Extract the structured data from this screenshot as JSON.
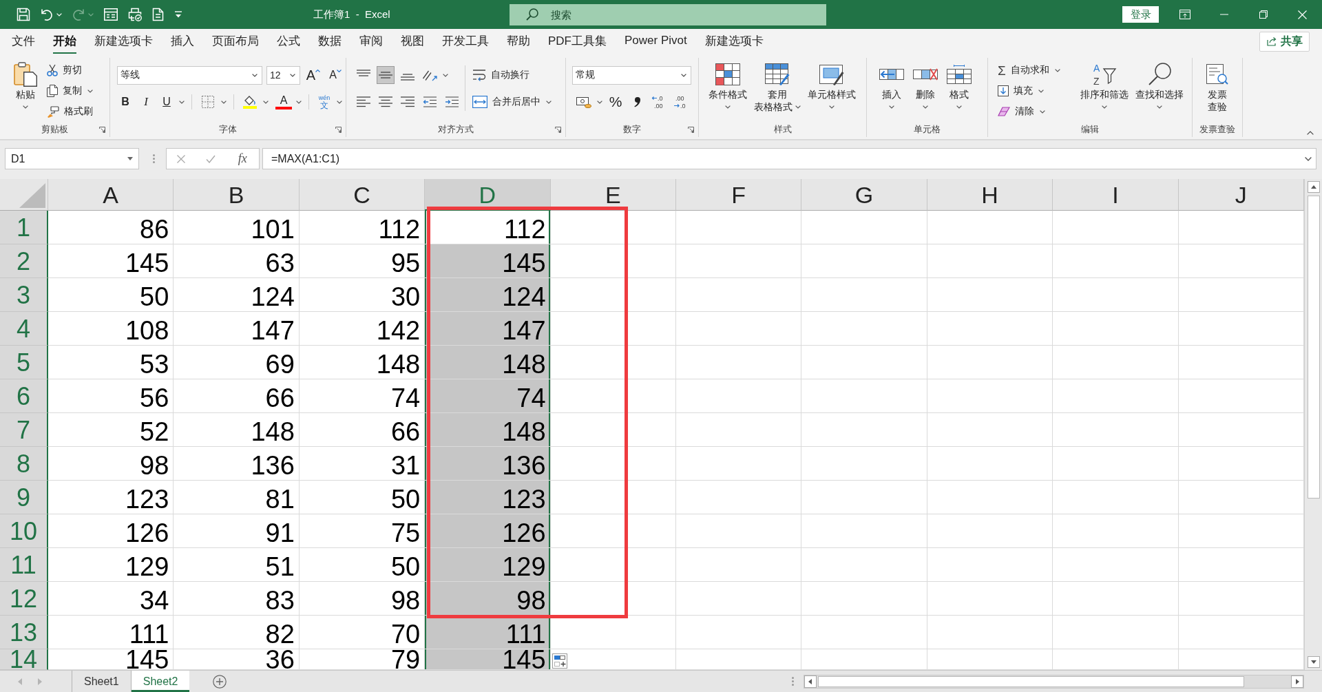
{
  "title_bar": {
    "quick_access": [
      {
        "kind": "save",
        "menu": false,
        "disabled": false
      },
      {
        "kind": "undo",
        "menu": true,
        "disabled": false
      },
      {
        "kind": "redo",
        "menu": true,
        "disabled": true
      },
      {
        "kind": "form",
        "menu": false,
        "disabled": false
      },
      {
        "kind": "preview",
        "menu": false,
        "disabled": false
      },
      {
        "kind": "document",
        "menu": false,
        "disabled": false
      },
      {
        "kind": "customize",
        "menu": false,
        "disabled": false
      }
    ],
    "title": "工作簿1  -  Excel",
    "search": {
      "placeholder": "搜索"
    },
    "sign_in": "登录"
  },
  "tabs": [
    {
      "label": "文件",
      "selected": false
    },
    {
      "label": "开始",
      "selected": true
    },
    {
      "label": "新建选项卡",
      "selected": false
    },
    {
      "label": "插入",
      "selected": false
    },
    {
      "label": "页面布局",
      "selected": false
    },
    {
      "label": "公式",
      "selected": false
    },
    {
      "label": "数据",
      "selected": false
    },
    {
      "label": "审阅",
      "selected": false
    },
    {
      "label": "视图",
      "selected": false
    },
    {
      "label": "开发工具",
      "selected": false
    },
    {
      "label": "帮助",
      "selected": false
    },
    {
      "label": "PDF工具集",
      "selected": false
    },
    {
      "label": "Power Pivot",
      "selected": false
    },
    {
      "label": "新建选项卡",
      "selected": false
    }
  ],
  "share": "共享",
  "ribbon": {
    "groups": [
      {
        "kind": "clipboard",
        "label": "剪贴板",
        "launcher": true,
        "items": [
          {
            "kind": "paste",
            "lines": [
              "粘贴"
            ],
            "menu": true
          },
          {
            "kind": "cut",
            "label": "剪切",
            "menu": false
          },
          {
            "kind": "copy",
            "label": "复制",
            "menu": true
          },
          {
            "kind": "painter",
            "label": "格式刷",
            "menu": false
          }
        ]
      },
      {
        "kind": "font",
        "label": "字体",
        "launcher": true,
        "items": [
          {
            "kind": "fontname",
            "value": "等线",
            "menu": true
          },
          {
            "kind": "fontsize",
            "value": "12",
            "menu": true
          },
          {
            "kind": "grow",
            "label": "A",
            "menu": false
          },
          {
            "kind": "shrink",
            "label": "A",
            "menu": false
          },
          {
            "kind": "bold",
            "label": "B",
            "menu": false
          },
          {
            "kind": "italic",
            "label": "I",
            "menu": false
          },
          {
            "kind": "underline",
            "label": "U",
            "menu": true
          },
          {
            "kind": "borders",
            "menu": true
          },
          {
            "kind": "fill",
            "color": "#ffff00",
            "menu": true
          },
          {
            "kind": "fontcolor",
            "label": "A",
            "color": "#ff0000",
            "menu": true
          },
          {
            "kind": "phonetic",
            "label": "wén",
            "base": "文",
            "menu": true
          }
        ]
      },
      {
        "kind": "alignment",
        "label": "对齐方式",
        "launcher": true,
        "vertical": [
          {
            "kind": "top",
            "selected": false
          },
          {
            "kind": "middle",
            "selected": true
          },
          {
            "kind": "bottom",
            "selected": false
          }
        ],
        "horizontal": [
          {
            "kind": "left",
            "selected": false
          },
          {
            "kind": "center",
            "selected": false
          },
          {
            "kind": "right",
            "selected": false
          }
        ],
        "items": [
          {
            "kind": "orientation",
            "menu": true
          },
          {
            "kind": "wrap",
            "label": "自动换行",
            "menu": false
          },
          {
            "kind": "outdent",
            "menu": false
          },
          {
            "kind": "indent",
            "menu": false
          },
          {
            "kind": "merge",
            "label": "合并后居中",
            "menu": true
          }
        ]
      },
      {
        "kind": "number",
        "label": "数字",
        "launcher": true,
        "items": [
          {
            "kind": "format",
            "value": "常规",
            "menu": true
          },
          {
            "kind": "accounting",
            "menu": true
          },
          {
            "kind": "percent",
            "label": "%",
            "menu": false
          },
          {
            "kind": "comma",
            "menu": false
          },
          {
            "kind": "moredecimals",
            "glyphs": [
              ".0",
              ".00"
            ],
            "menu": false
          },
          {
            "kind": "fewerdecimals",
            "glyphs": [
              ".00",
              ".0"
            ],
            "menu": false
          }
        ]
      },
      {
        "kind": "styles",
        "label": "样式",
        "launcher": false,
        "items": [
          {
            "kind": "conditional",
            "lines": [
              "条件格式"
            ],
            "menu": true
          },
          {
            "kind": "table",
            "lines": [
              "套用",
              "表格格式"
            ],
            "menu": true
          },
          {
            "kind": "cellstyles",
            "lines": [
              "单元格样式"
            ],
            "menu": true
          }
        ]
      },
      {
        "kind": "cells",
        "label": "单元格",
        "launcher": false,
        "items": [
          {
            "kind": "insert",
            "lines": [
              "插入"
            ],
            "menu": true
          },
          {
            "kind": "delete",
            "lines": [
              "删除"
            ],
            "menu": true
          },
          {
            "kind": "cellformat",
            "lines": [
              "格式"
            ],
            "menu": true
          }
        ]
      },
      {
        "kind": "editing",
        "label": "编辑",
        "launcher": false,
        "items": [
          {
            "kind": "autosum",
            "glyph": "Σ",
            "label": "自动求和",
            "menu": true
          },
          {
            "kind": "filldown",
            "label": "填充",
            "menu": true
          },
          {
            "kind": "clear",
            "label": "清除",
            "menu": true
          },
          {
            "kind": "sort",
            "glyphs": [
              "A",
              "Z"
            ],
            "lines": [
              "排序和筛选"
            ],
            "menu": true
          },
          {
            "kind": "find",
            "lines": [
              "查找和选择"
            ],
            "menu": true
          }
        ]
      },
      {
        "kind": "invoice",
        "label": "发票查验",
        "launcher": false,
        "items": [
          {
            "kind": "invoice",
            "lines": [
              "发票",
              "查验"
            ],
            "menu": false
          }
        ]
      }
    ]
  },
  "formula_bar": {
    "name_box": "D1",
    "fx": "fx",
    "formula": "=MAX(A1:C1)"
  },
  "sheet": {
    "columns": [
      {
        "label": "A",
        "selected": false
      },
      {
        "label": "B",
        "selected": false
      },
      {
        "label": "C",
        "selected": false
      },
      {
        "label": "D",
        "selected": true
      },
      {
        "label": "E",
        "selected": false
      },
      {
        "label": "F",
        "selected": false
      },
      {
        "label": "G",
        "selected": false
      },
      {
        "label": "H",
        "selected": false
      },
      {
        "label": "I",
        "selected": false
      },
      {
        "label": "J",
        "selected": false
      }
    ],
    "rows": [
      {
        "label": "1",
        "selected": true,
        "cells": [
          {
            "value": "86",
            "selected": false,
            "active": false
          },
          {
            "value": "101",
            "selected": false,
            "active": false
          },
          {
            "value": "112",
            "selected": false,
            "active": false
          },
          {
            "value": "112",
            "selected": true,
            "active": true
          }
        ]
      },
      {
        "label": "2",
        "selected": true,
        "cells": [
          {
            "value": "145",
            "selected": false,
            "active": false
          },
          {
            "value": "63",
            "selected": false,
            "active": false
          },
          {
            "value": "95",
            "selected": false,
            "active": false
          },
          {
            "value": "145",
            "selected": true,
            "active": false
          }
        ]
      },
      {
        "label": "3",
        "selected": true,
        "cells": [
          {
            "value": "50",
            "selected": false,
            "active": false
          },
          {
            "value": "124",
            "selected": false,
            "active": false
          },
          {
            "value": "30",
            "selected": false,
            "active": false
          },
          {
            "value": "124",
            "selected": true,
            "active": false
          }
        ]
      },
      {
        "label": "4",
        "selected": true,
        "cells": [
          {
            "value": "108",
            "selected": false,
            "active": false
          },
          {
            "value": "147",
            "selected": false,
            "active": false
          },
          {
            "value": "142",
            "selected": false,
            "active": false
          },
          {
            "value": "147",
            "selected": true,
            "active": false
          }
        ]
      },
      {
        "label": "5",
        "selected": true,
        "cells": [
          {
            "value": "53",
            "selected": false,
            "active": false
          },
          {
            "value": "69",
            "selected": false,
            "active": false
          },
          {
            "value": "148",
            "selected": false,
            "active": false
          },
          {
            "value": "148",
            "selected": true,
            "active": false
          }
        ]
      },
      {
        "label": "6",
        "selected": true,
        "cells": [
          {
            "value": "56",
            "selected": false,
            "active": false
          },
          {
            "value": "66",
            "selected": false,
            "active": false
          },
          {
            "value": "74",
            "selected": false,
            "active": false
          },
          {
            "value": "74",
            "selected": true,
            "active": false
          }
        ]
      },
      {
        "label": "7",
        "selected": true,
        "cells": [
          {
            "value": "52",
            "selected": false,
            "active": false
          },
          {
            "value": "148",
            "selected": false,
            "active": false
          },
          {
            "value": "66",
            "selected": false,
            "active": false
          },
          {
            "value": "148",
            "selected": true,
            "active": false
          }
        ]
      },
      {
        "label": "8",
        "selected": true,
        "cells": [
          {
            "value": "98",
            "selected": false,
            "active": false
          },
          {
            "value": "136",
            "selected": false,
            "active": false
          },
          {
            "value": "31",
            "selected": false,
            "active": false
          },
          {
            "value": "136",
            "selected": true,
            "active": false
          }
        ]
      },
      {
        "label": "9",
        "selected": true,
        "cells": [
          {
            "value": "123",
            "selected": false,
            "active": false
          },
          {
            "value": "81",
            "selected": false,
            "active": false
          },
          {
            "value": "50",
            "selected": false,
            "active": false
          },
          {
            "value": "123",
            "selected": true,
            "active": false
          }
        ]
      },
      {
        "label": "10",
        "selected": true,
        "cells": [
          {
            "value": "126",
            "selected": false,
            "active": false
          },
          {
            "value": "91",
            "selected": false,
            "active": false
          },
          {
            "value": "75",
            "selected": false,
            "active": false
          },
          {
            "value": "126",
            "selected": true,
            "active": false
          }
        ]
      },
      {
        "label": "11",
        "selected": true,
        "cells": [
          {
            "value": "129",
            "selected": false,
            "active": false
          },
          {
            "value": "51",
            "selected": false,
            "active": false
          },
          {
            "value": "50",
            "selected": false,
            "active": false
          },
          {
            "value": "129",
            "selected": true,
            "active": false
          }
        ]
      },
      {
        "label": "12",
        "selected": true,
        "cells": [
          {
            "value": "34",
            "selected": false,
            "active": false
          },
          {
            "value": "83",
            "selected": false,
            "active": false
          },
          {
            "value": "98",
            "selected": false,
            "active": false
          },
          {
            "value": "98",
            "selected": true,
            "active": false
          }
        ]
      },
      {
        "label": "13",
        "selected": true,
        "cells": [
          {
            "value": "111",
            "selected": false,
            "active": false
          },
          {
            "value": "82",
            "selected": false,
            "active": false
          },
          {
            "value": "70",
            "selected": false,
            "active": false
          },
          {
            "value": "111",
            "selected": true,
            "active": false
          }
        ]
      },
      {
        "label": "14",
        "selected": true,
        "cells": [
          {
            "value": "145",
            "selected": false,
            "active": false
          },
          {
            "value": "36",
            "selected": false,
            "active": false
          },
          {
            "value": "79",
            "selected": false,
            "active": false
          },
          {
            "value": "145",
            "selected": true,
            "active": false
          }
        ]
      }
    ]
  },
  "highlight": {
    "kind": "rectangle"
  },
  "sheet_tabs": [
    {
      "label": "Sheet1",
      "selected": false
    },
    {
      "label": "Sheet2",
      "selected": true
    }
  ]
}
